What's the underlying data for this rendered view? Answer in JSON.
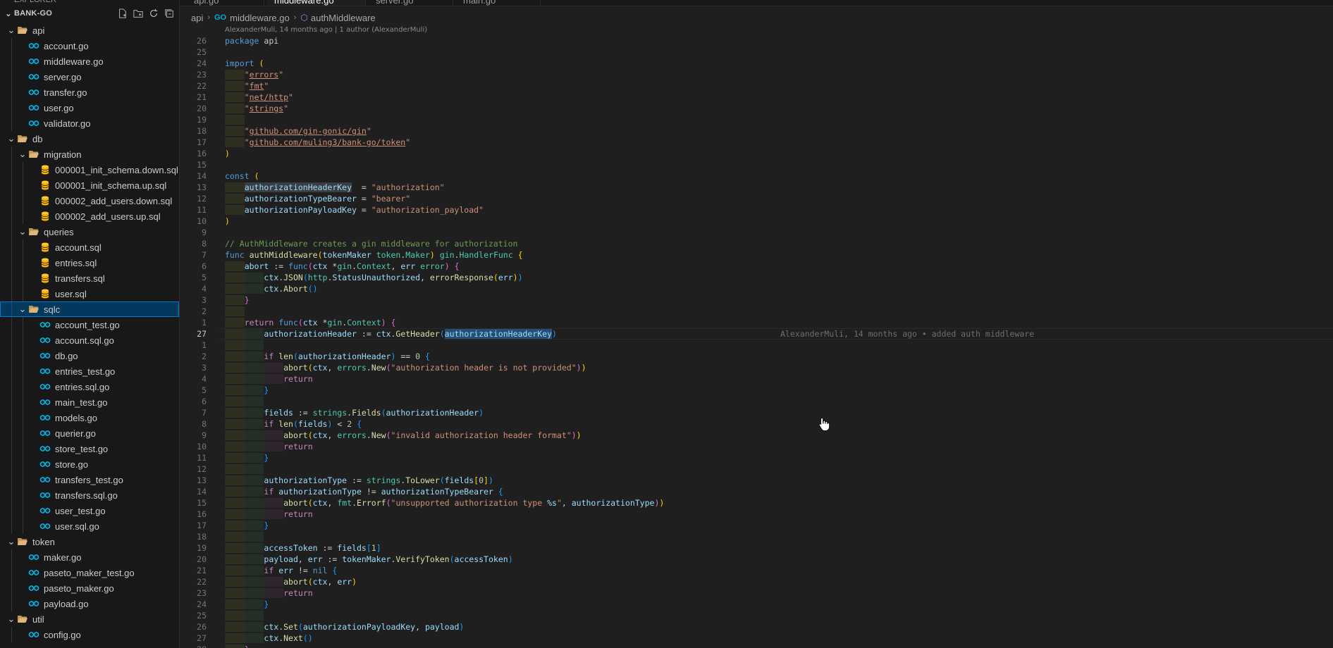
{
  "explorer": {
    "top_label": "EXPLORER",
    "section_title": "BANK-GO",
    "actions": [
      "new-file-icon",
      "new-folder-icon",
      "refresh-icon",
      "collapse-all-icon"
    ]
  },
  "tree": [
    {
      "label": "api",
      "kind": "folder",
      "depth": 0,
      "open": true
    },
    {
      "label": "account.go",
      "kind": "go",
      "depth": 1
    },
    {
      "label": "middleware.go",
      "kind": "go",
      "depth": 1
    },
    {
      "label": "server.go",
      "kind": "go",
      "depth": 1
    },
    {
      "label": "transfer.go",
      "kind": "go",
      "depth": 1
    },
    {
      "label": "user.go",
      "kind": "go",
      "depth": 1
    },
    {
      "label": "validator.go",
      "kind": "go",
      "depth": 1
    },
    {
      "label": "db",
      "kind": "folder",
      "depth": 0,
      "open": true
    },
    {
      "label": "migration",
      "kind": "folder",
      "depth": 1,
      "open": true
    },
    {
      "label": "000001_init_schema.down.sql",
      "kind": "sql",
      "depth": 2
    },
    {
      "label": "000001_init_schema.up.sql",
      "kind": "sql",
      "depth": 2
    },
    {
      "label": "000002_add_users.down.sql",
      "kind": "sql",
      "depth": 2
    },
    {
      "label": "000002_add_users.up.sql",
      "kind": "sql",
      "depth": 2
    },
    {
      "label": "queries",
      "kind": "folder",
      "depth": 1,
      "open": true
    },
    {
      "label": "account.sql",
      "kind": "sql",
      "depth": 2
    },
    {
      "label": "entries.sql",
      "kind": "sql",
      "depth": 2
    },
    {
      "label": "transfers.sql",
      "kind": "sql",
      "depth": 2
    },
    {
      "label": "user.sql",
      "kind": "sql",
      "depth": 2
    },
    {
      "label": "sqlc",
      "kind": "folder",
      "depth": 1,
      "open": true,
      "selected": true
    },
    {
      "label": "account_test.go",
      "kind": "go",
      "depth": 2
    },
    {
      "label": "account.sql.go",
      "kind": "go",
      "depth": 2
    },
    {
      "label": "db.go",
      "kind": "go",
      "depth": 2
    },
    {
      "label": "entries_test.go",
      "kind": "go",
      "depth": 2
    },
    {
      "label": "entries.sql.go",
      "kind": "go",
      "depth": 2
    },
    {
      "label": "main_test.go",
      "kind": "go",
      "depth": 2
    },
    {
      "label": "models.go",
      "kind": "go",
      "depth": 2
    },
    {
      "label": "querier.go",
      "kind": "go",
      "depth": 2
    },
    {
      "label": "store_test.go",
      "kind": "go",
      "depth": 2
    },
    {
      "label": "store.go",
      "kind": "go",
      "depth": 2
    },
    {
      "label": "transfers_test.go",
      "kind": "go",
      "depth": 2
    },
    {
      "label": "transfers.sql.go",
      "kind": "go",
      "depth": 2
    },
    {
      "label": "user_test.go",
      "kind": "go",
      "depth": 2
    },
    {
      "label": "user.sql.go",
      "kind": "go",
      "depth": 2
    },
    {
      "label": "token",
      "kind": "folder",
      "depth": 0,
      "open": true
    },
    {
      "label": "maker.go",
      "kind": "go",
      "depth": 1
    },
    {
      "label": "paseto_maker_test.go",
      "kind": "go",
      "depth": 1
    },
    {
      "label": "paseto_maker.go",
      "kind": "go",
      "depth": 1
    },
    {
      "label": "payload.go",
      "kind": "go",
      "depth": 1
    },
    {
      "label": "util",
      "kind": "folder",
      "depth": 0,
      "open": true
    },
    {
      "label": "config.go",
      "kind": "go",
      "depth": 1
    }
  ],
  "tabs": [
    {
      "label": "api.go",
      "active": false
    },
    {
      "label": "middleware.go",
      "active": true
    },
    {
      "label": "server.go",
      "active": false
    },
    {
      "label": "main.go",
      "active": false
    }
  ],
  "breadcrumb": {
    "folder": "api",
    "file": "middleware.go",
    "symbol": "authMiddleware"
  },
  "editor": {
    "blame_header": "AlexanderMuli, 14 months ago | 1 author (AlexanderMuli)",
    "inline_blame": "AlexanderMuli, 14 months ago • added auth middleware",
    "current_line_number": "27"
  }
}
